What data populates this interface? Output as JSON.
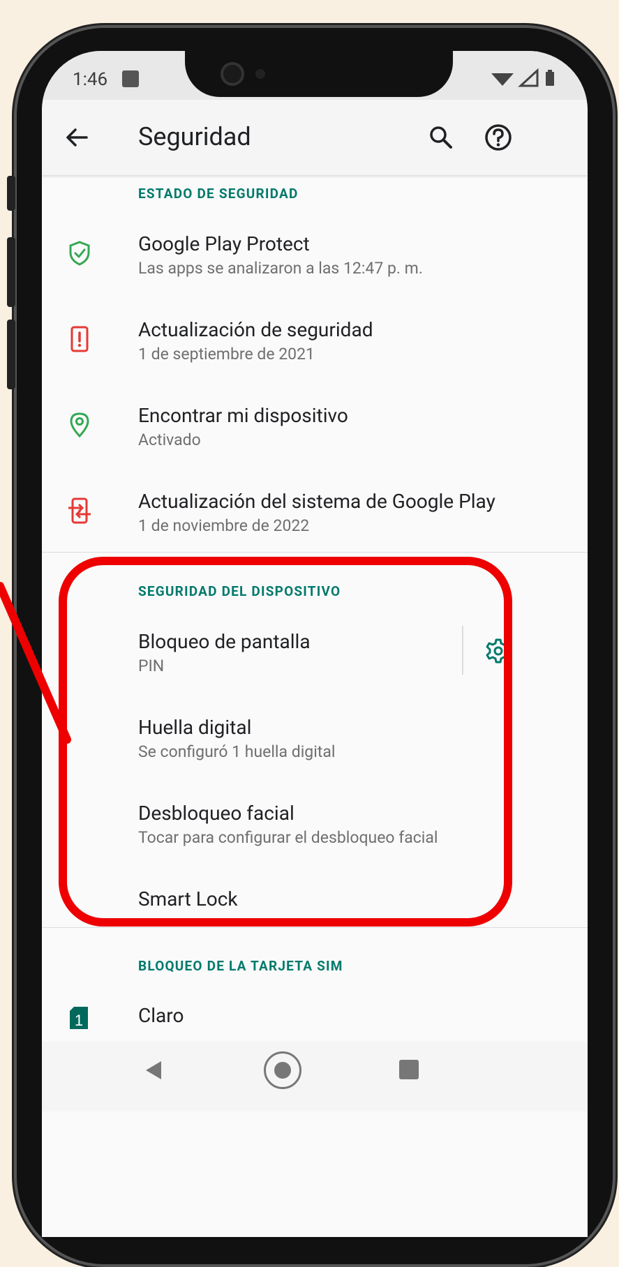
{
  "status": {
    "time": "1:46"
  },
  "appbar": {
    "title": "Seguridad"
  },
  "sections": {
    "security_status": "ESTADO DE SEGURIDAD",
    "device_security": "SEGURIDAD DEL DISPOSITIVO",
    "sim_lock": "BLOQUEO DE LA TARJETA SIM"
  },
  "items": {
    "play_protect": {
      "title": "Google Play Protect",
      "subtitle": "Las apps se analizaron a las 12:47 p. m."
    },
    "security_update": {
      "title": "Actualización de seguridad",
      "subtitle": "1 de septiembre de 2021"
    },
    "find_device": {
      "title": "Encontrar mi dispositivo",
      "subtitle": "Activado"
    },
    "play_system_update": {
      "title": "Actualización del sistema de Google Play",
      "subtitle": "1 de noviembre de 2022"
    },
    "screen_lock": {
      "title": "Bloqueo de pantalla",
      "subtitle": "PIN"
    },
    "fingerprint": {
      "title": "Huella digital",
      "subtitle": "Se configuró 1 huella digital"
    },
    "face_unlock": {
      "title": "Desbloqueo facial",
      "subtitle": "Tocar para configurar el desbloqueo facial"
    },
    "smart_lock": {
      "title": "Smart Lock"
    },
    "sim": {
      "title": "Claro",
      "badge": "1"
    }
  },
  "colors": {
    "accent": "#00796b",
    "green_icon": "#34a853",
    "red_icon": "#e53935",
    "highlight": "#ee0000"
  },
  "icons": {
    "play_protect": "shield-check-icon",
    "security_update": "phone-alert-icon",
    "find_device": "location-pin-icon",
    "play_system_update": "system-update-icon",
    "screen_lock_settings": "gear-icon",
    "sim": "sim-card-icon"
  }
}
